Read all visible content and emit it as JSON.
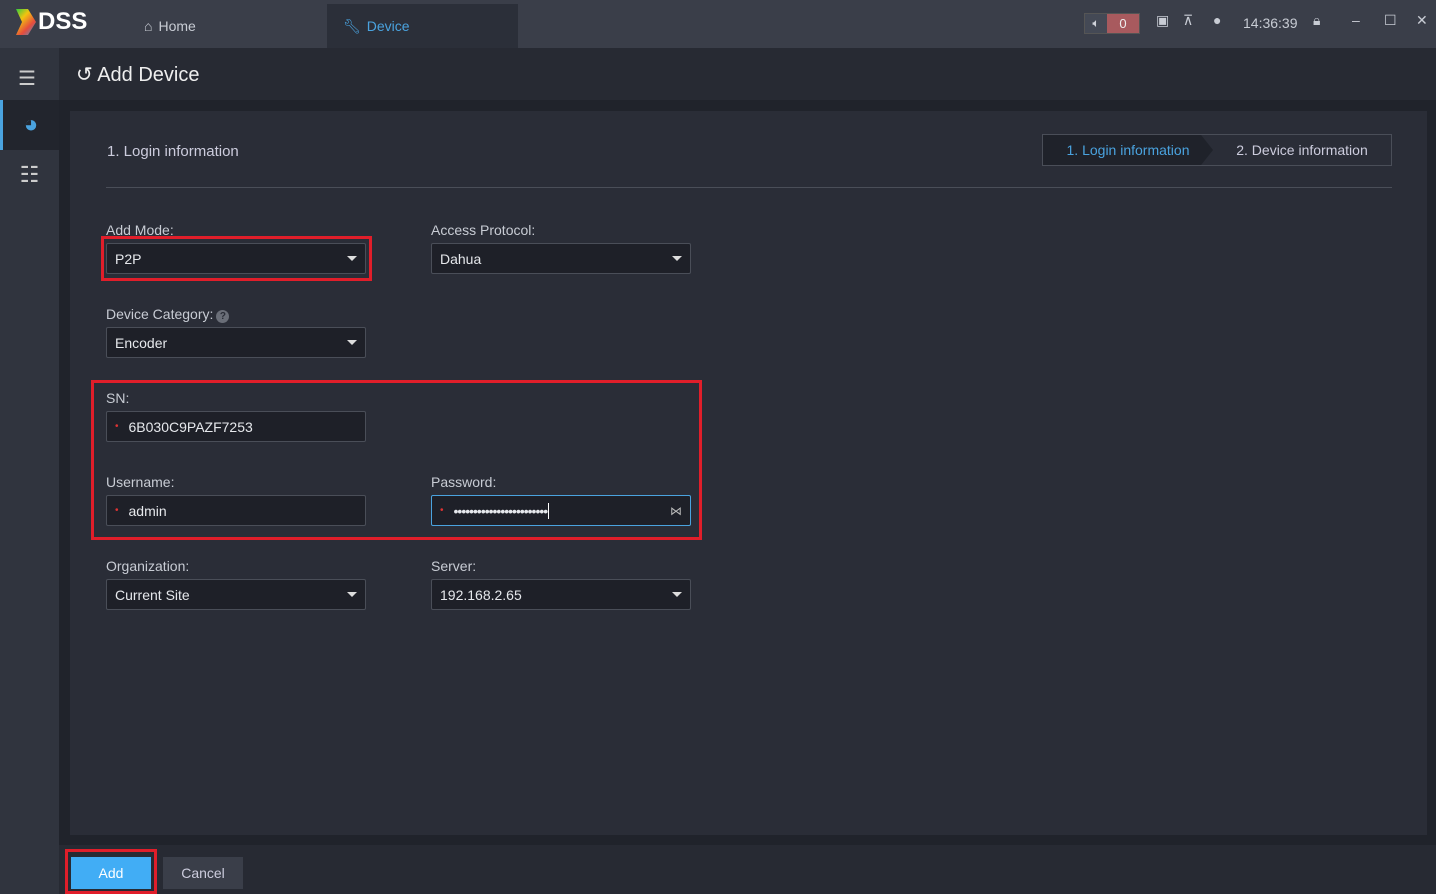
{
  "app": {
    "logo": "DSS",
    "time": "14:36:39",
    "alarm_count": "0"
  },
  "tabs": [
    {
      "label": "Home"
    },
    {
      "label": "Device"
    }
  ],
  "page": {
    "title": "Add Device",
    "section": "1. Login information"
  },
  "steps": [
    "1. Login information",
    "2. Device information"
  ],
  "form": {
    "add_mode": {
      "label": "Add Mode:",
      "value": "P2P"
    },
    "access_protocol": {
      "label": "Access Protocol:",
      "value": "Dahua"
    },
    "device_category": {
      "label": "Device Category:",
      "value": "Encoder"
    },
    "sn": {
      "label": "SN:",
      "value": "6B030C9PAZF7253"
    },
    "username": {
      "label": "Username:",
      "value": "admin"
    },
    "password": {
      "label": "Password:",
      "value": "••••••••••••••••••••••••"
    },
    "organization": {
      "label": "Organization:",
      "value": "Current Site"
    },
    "server": {
      "label": "Server:",
      "value": "192.168.2.65"
    }
  },
  "buttons": {
    "add": "Add",
    "cancel": "Cancel"
  },
  "colors": {
    "accent": "#4aa3df",
    "highlight": "#e01e2a",
    "primary_button": "#41adf5"
  }
}
